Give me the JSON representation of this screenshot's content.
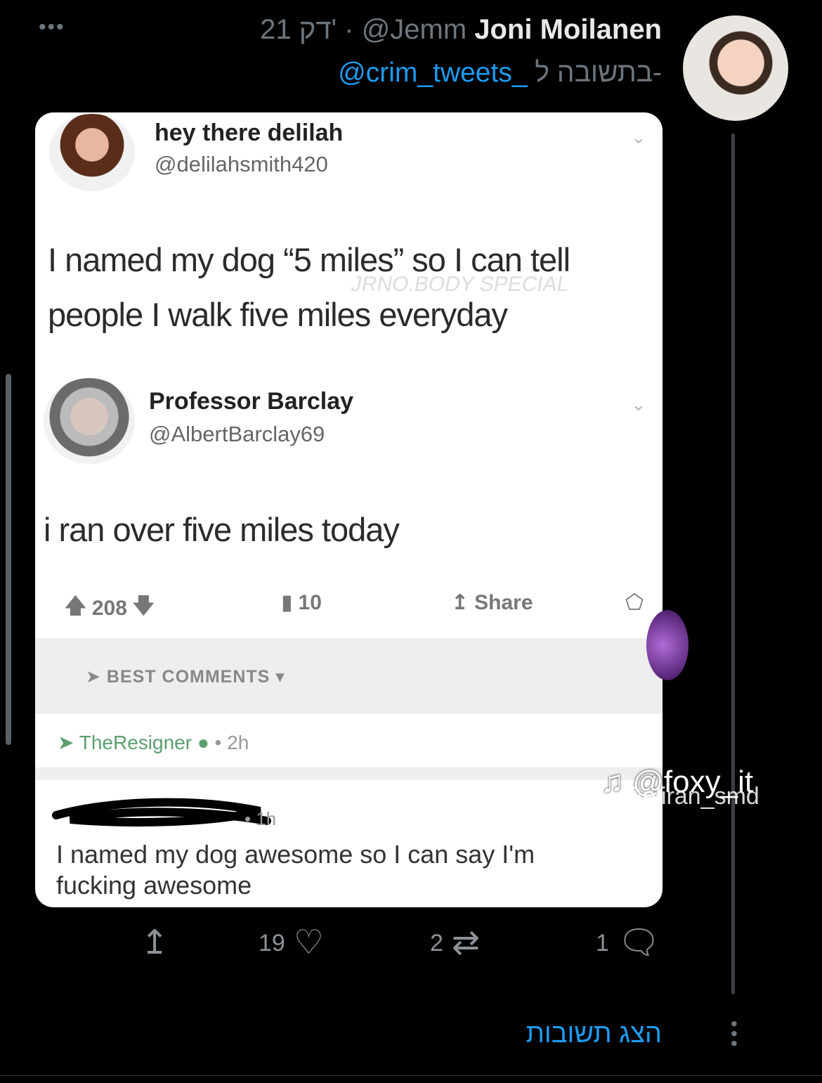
{
  "header": {
    "more": "•••",
    "time": "21 דק'",
    "handle": "@Jemm",
    "separator": "·",
    "display_name": "Joni Moilanen"
  },
  "reply": {
    "prefix": "בתשובה ל-",
    "handle": "@crim_tweets_"
  },
  "embedded": {
    "tweet1": {
      "name": "hey there delilah",
      "handle": "@delilahsmith420",
      "text_line1": "I named my dog “5 miles” so I can tell",
      "text_line2": "people I walk five miles everyday",
      "faint_watermark": "JRNO.BODY  SPECIAL"
    },
    "tweet2": {
      "name": "Professor Barclay",
      "handle": "@AlbertBarclay69",
      "text": "i ran over five miles today"
    },
    "actions": {
      "upvotes": "208",
      "comments": "10",
      "share": "Share"
    },
    "best_comments": "BEST COMMENTS ▾",
    "comment1": {
      "user": "TheResigner",
      "time": "• 2h"
    },
    "comment2": {
      "time": "• 1h",
      "text": "I named my dog awesome so I can say I'm fucking awesome"
    },
    "tiktok_watermark": "@foxy_it",
    "tiktok_watermark2": "@eliran_smd"
  },
  "actions": {
    "likes": "19",
    "retweets": "2",
    "replies": "1"
  },
  "show_replies": "הצג תשובות",
  "colors": {
    "background": "#000000",
    "link": "#1d9bf0",
    "muted": "#6e767d"
  }
}
